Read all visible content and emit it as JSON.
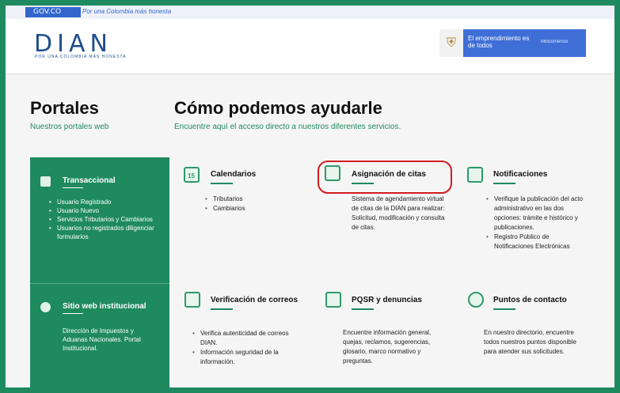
{
  "gov_bar": {
    "logo": "GOV.CO",
    "text": "Por una Colombia más honesta"
  },
  "header": {
    "logo": "DIAN",
    "slogan": "POR UNA COLOMBIA MÁS HONESTA",
    "banner_text": "El emprendimiento es de todos",
    "banner_ministry": "Mincomercio"
  },
  "portales": {
    "title": "Portales",
    "subtitle": "Nuestros portales web"
  },
  "ayuda": {
    "title": "Cómo podemos ayudarle",
    "subtitle": "Encuentre aquí el acceso directo a nuestros diferentes servicios."
  },
  "sidebar": {
    "transaccional": {
      "title": "Transaccional",
      "items": [
        "Usuario Registrado",
        "Usuario Nuevo",
        "Servicios Tributarios y Cambiarios",
        "Usuarios no registrados diligenciar formularios"
      ]
    },
    "institucional": {
      "title": "Sitio web institucional",
      "description": "Dirección de Impuestos y Aduanas Nacionales. Portal Institucional."
    }
  },
  "cards": {
    "calendarios": {
      "title": "Calendarios",
      "icon_number": "15",
      "items": [
        "Tributarios",
        "Cambiarios"
      ]
    },
    "citas": {
      "title": "Asignación de citas",
      "description": "Sistema de agendamiento virtual de citas de la DIAN para realizar: Solicitud, modificación y consulta de citas."
    },
    "notificaciones": {
      "title": "Notificaciones",
      "items": [
        "Verifique la publicación del acto administrativo en las dos opciones: trámite e histórico y publicaciones.",
        "Registro Público de Notificaciones Electrónicas"
      ]
    },
    "correos": {
      "title": "Verificación de correos",
      "items": [
        "Verifica autenticidad de correos DIAN.",
        "Información seguridad de la información."
      ]
    },
    "pqsr": {
      "title": "PQSR y denuncias",
      "description": "Encuentre información general, quejas, reclamos, sugerencias, glosario, marco normativo y preguntas."
    },
    "contacto": {
      "title": "Puntos de contacto",
      "description": "En nuestro directorio, encuentre todos nuestros puntos disponible para atender sus solicitudes."
    }
  },
  "colors": {
    "frame": "#1f8a60",
    "accent_green": "#1e8a5e",
    "highlight": "#d11c1c",
    "gov_blue": "#3366cc"
  }
}
